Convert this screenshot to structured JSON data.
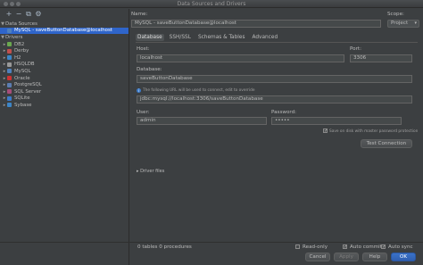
{
  "window": {
    "title": "Data Sources and Drivers"
  },
  "toolbar": {
    "add": "+",
    "remove": "−",
    "copy": "⧉",
    "settings": "⚙"
  },
  "tree": {
    "data_sources_label": "Data Sources",
    "selected_source": "MySQL - saveButtonDatabase@localhost",
    "drivers_label": "Drivers",
    "drivers": [
      "DB2",
      "Derby",
      "H2",
      "HSQLDB",
      "MySQL",
      "Oracle",
      "PostgreSQL",
      "SQL Server",
      "SQLite",
      "Sybase"
    ],
    "driver_colors": [
      "#6aa84f",
      "#c0504d",
      "#3d85c6",
      "#999999",
      "#4f81bd",
      "#cc3333",
      "#5b7db1",
      "#a64d79",
      "#3d7bc9",
      "#3d85c6"
    ]
  },
  "form": {
    "name_label": "Name:",
    "name_value": "MySQL - saveButtonDatabase@localhost",
    "scope_label": "Scope:",
    "scope_value": "Project",
    "tabs": [
      "Database",
      "SSH/SSL",
      "Schemas & Tables",
      "Advanced"
    ],
    "host_label": "Host:",
    "host_value": "localhost",
    "port_label": "Port:",
    "port_value": "3306",
    "database_label": "Database:",
    "database_value": "saveButtonDatabase",
    "url_info": "The following URL will be used to connect, edit to override",
    "url_value": "jdbc:mysql://localhost:3306/saveButtonDatabase",
    "user_label": "User:",
    "user_value": "admin",
    "password_label": "Password:",
    "password_value": "•••••",
    "save_password_label": "Save on disk with master password protection",
    "test_connection": "Test Connection",
    "driver_files": "Driver files"
  },
  "status": {
    "summary": "0 tables 0 procedures",
    "read_only": "Read-only",
    "auto_commit": "Auto commit",
    "auto_sync": "Auto sync"
  },
  "buttons": {
    "cancel": "Cancel",
    "apply": "Apply",
    "help": "Help",
    "ok": "OK"
  }
}
